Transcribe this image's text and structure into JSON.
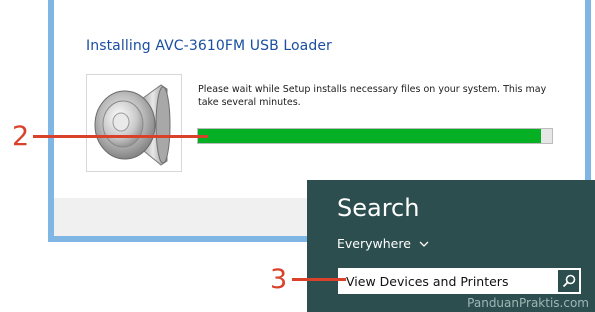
{
  "installer": {
    "title": "Installing AVC-3610FM USB Loader",
    "message": "Please wait while Setup installs necessary files on your system. This may take several minutes.",
    "progress": 0.97,
    "progress_color": "#06b025",
    "icon": "speaker-icon"
  },
  "annotations": {
    "step_progress": "2",
    "step_search": "3"
  },
  "search": {
    "heading": "Search",
    "scope": "Everywhere",
    "value": "View Devices and Printers",
    "clear_icon": "close-icon",
    "submit_icon": "search-icon"
  },
  "watermark": "PanduanPraktis.com",
  "colors": {
    "annotation": "#d9412b",
    "charm_background": "#2d4e4e",
    "title_blue": "#1a4fa0"
  }
}
